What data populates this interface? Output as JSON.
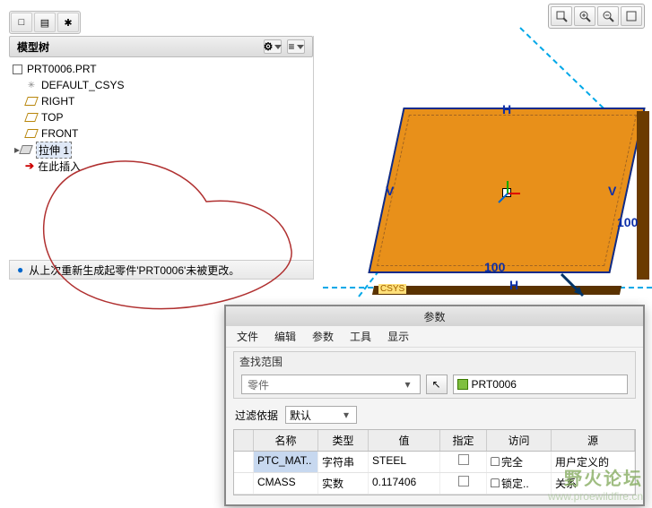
{
  "toolbar": {
    "view_combo": "□□",
    "t1": "□",
    "t2": "▤",
    "t3": "✱"
  },
  "view_tools": {
    "fit": "⤢",
    "zoom_in": "+",
    "zoom_out": "−",
    "extra": "◫"
  },
  "panel": {
    "title": "模型树",
    "tool_a": "⚙",
    "tool_b": "≡"
  },
  "tree": {
    "part": "PRT0006.PRT",
    "csys": "DEFAULT_CSYS",
    "right": "RIGHT",
    "top": "TOP",
    "front": "FRONT",
    "feature": "拉伸 1",
    "insert": "在此插入"
  },
  "message": "从上次重新生成起零件'PRT0006'未被更改。",
  "dims": {
    "h": "H",
    "v": "V",
    "len": "100",
    "len_r": "100"
  },
  "csys_label": "CSYS",
  "dlg": {
    "title": "参数",
    "menu": [
      "文件",
      "编辑",
      "参数",
      "工具",
      "显示"
    ],
    "scope_label": "查找范围",
    "scope_value": "零件",
    "pick_arrow": "↖",
    "pick_name": "PRT0006",
    "filter_label": "过滤依据",
    "filter_value": "默认",
    "cols": {
      "name": "名称",
      "type": "类型",
      "val": "值",
      "spec": "指定",
      "acc": "访问",
      "src": "源"
    },
    "rows": [
      {
        "name": "PTC_MAT..",
        "type": "字符串",
        "val": "STEEL",
        "spec": false,
        "acc_icon": "lock",
        "acc": "完全",
        "src": "用户定义的"
      },
      {
        "name": "CMASS",
        "type": "实数",
        "val": "0.117406",
        "spec": false,
        "acc_icon": "lock",
        "acc": "锁定..",
        "src": "关系"
      }
    ]
  },
  "watermark": {
    "l1": "野火论坛",
    "l2": "www.proewildfire.cn"
  }
}
